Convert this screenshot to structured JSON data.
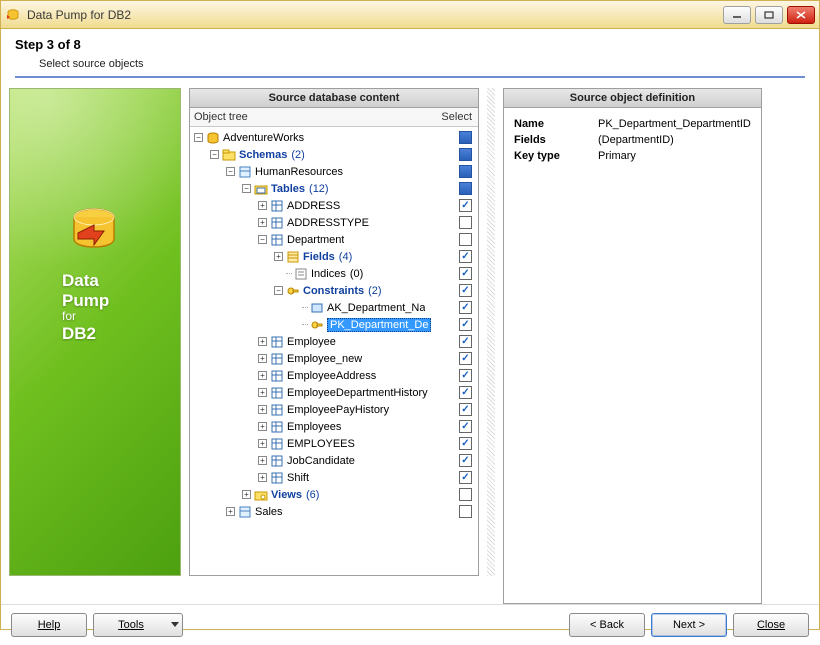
{
  "window": {
    "title": "Data Pump for DB2"
  },
  "step": {
    "title": "Step 3 of 8",
    "subtitle": "Select source objects"
  },
  "banner": {
    "line1": "Data",
    "line2": "Pump",
    "line3_small": "for",
    "line4": "DB2"
  },
  "panel_left": {
    "title": "Source database content",
    "header_col1": "Object tree",
    "header_col2": "Select"
  },
  "panel_right": {
    "title": "Source object definition"
  },
  "tree": {
    "root": "AdventureWorks",
    "schemas_label": "Schemas",
    "schemas_count": "(2)",
    "hr": "HumanResources",
    "tables_label": "Tables",
    "tables_count": "(12)",
    "t_address": "ADDRESS",
    "t_addresstype": "ADDRESSTYPE",
    "t_department": "Department",
    "fields_label": "Fields",
    "fields_count": "(4)",
    "indices_label": "Indices",
    "indices_count": "(0)",
    "constraints_label": "Constraints",
    "constraints_count": "(2)",
    "c_ak": "AK_Department_Na",
    "c_pk": "PK_Department_De",
    "t_employee": "Employee",
    "t_employee_new": "Employee_new",
    "t_employeeaddr": "EmployeeAddress",
    "t_empdepthist": "EmployeeDepartmentHistory",
    "t_emppayhist": "EmployeePayHistory",
    "t_employees": "Employees",
    "t_EMPLOYEES": "EMPLOYEES",
    "t_jobcand": "JobCandidate",
    "t_shift": "Shift",
    "views_label": "Views",
    "views_count": "(6)",
    "sales": "Sales"
  },
  "definition": {
    "name_k": "Name",
    "name_v": "PK_Department_DepartmentID",
    "fields_k": "Fields",
    "fields_v": "(DepartmentID)",
    "keytype_k": "Key type",
    "keytype_v": "Primary"
  },
  "buttons": {
    "help": "Help",
    "tools": "Tools",
    "back": "< Back",
    "next": "Next >",
    "close": "Close"
  }
}
